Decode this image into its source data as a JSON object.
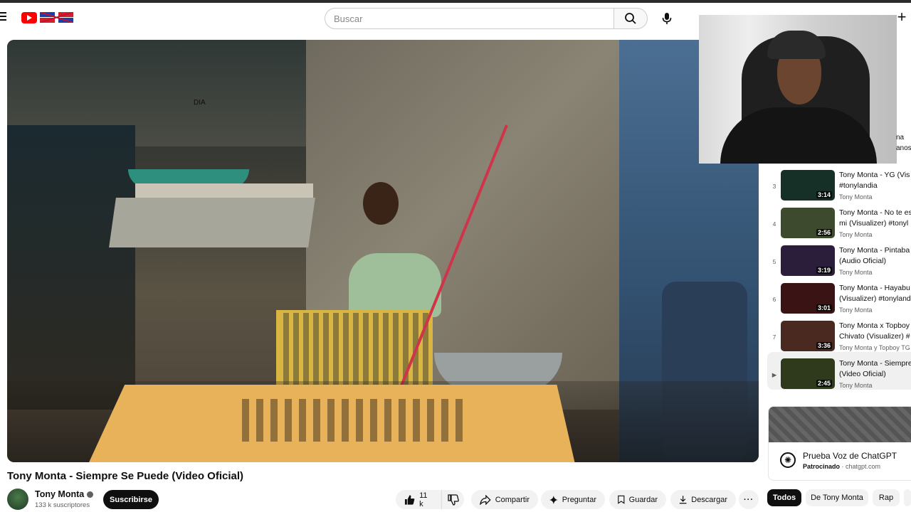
{
  "header": {
    "search_placeholder": "Buscar"
  },
  "video": {
    "title": "Tony Monta - Siempre Se Puede (Video Oficial)",
    "channel": "Tony Monta",
    "subscribers": "133 k suscriptores",
    "subscribe_label": "Suscribirse"
  },
  "actions": {
    "likes": "11 k",
    "share": "Compartir",
    "ask": "Preguntar",
    "save": "Guardar",
    "download": "Descargar",
    "more": "···"
  },
  "playlist": {
    "items": [
      {
        "index": "3",
        "title": "Tony Monta - YG (Vis",
        "title2": "#tonylandia",
        "channel": "Tony Monta",
        "duration": "3:14",
        "thumb_color": "#1f3a30"
      },
      {
        "index": "4",
        "title": "Tony Monta - No te es",
        "title2": "mi (Visualizer) #tonyl",
        "channel": "Tony Monta",
        "duration": "2:56",
        "thumb_color": "#3d4a2e"
      },
      {
        "index": "5",
        "title": "Tony Monta - Pintaba",
        "title2": "(Audio Oficial)",
        "channel": "Tony Monta",
        "duration": "3:19",
        "thumb_color": "#2a1e3a"
      },
      {
        "index": "6",
        "title": "Tony Monta - Hayabu",
        "title2": "(Visualizer) #tonyland",
        "channel": "Tony Monta",
        "duration": "3:01",
        "thumb_color": "#3a1414"
      },
      {
        "index": "7",
        "title": "Tony Monta x Topboy",
        "title2": "Chivato (Visualizer) #",
        "channel": "Tony Monta y Topboy TG",
        "duration": "3:36",
        "thumb_color": "#4a2a20"
      },
      {
        "index": "▶",
        "title": "Tony Monta - Siempre",
        "title2": "(Video Oficial)",
        "channel": "Tony Monta",
        "duration": "2:45",
        "thumb_color": "#2f3a1c"
      }
    ]
  },
  "webcam_overflow": {
    "line1": "DIA",
    "line2": "na",
    "line3": "anos"
  },
  "ad": {
    "title": "Prueba Voz de ChatGPT",
    "sponsored": "Patrocinado",
    "domain": "chatgpt.com"
  },
  "chips": [
    "Todos",
    "De Tony Monta",
    "Rap"
  ],
  "colors": {
    "brand_red": "#ff0000",
    "text_primary": "#0f0f0f",
    "text_secondary": "#606060",
    "chip_bg": "#f2f2f2"
  }
}
